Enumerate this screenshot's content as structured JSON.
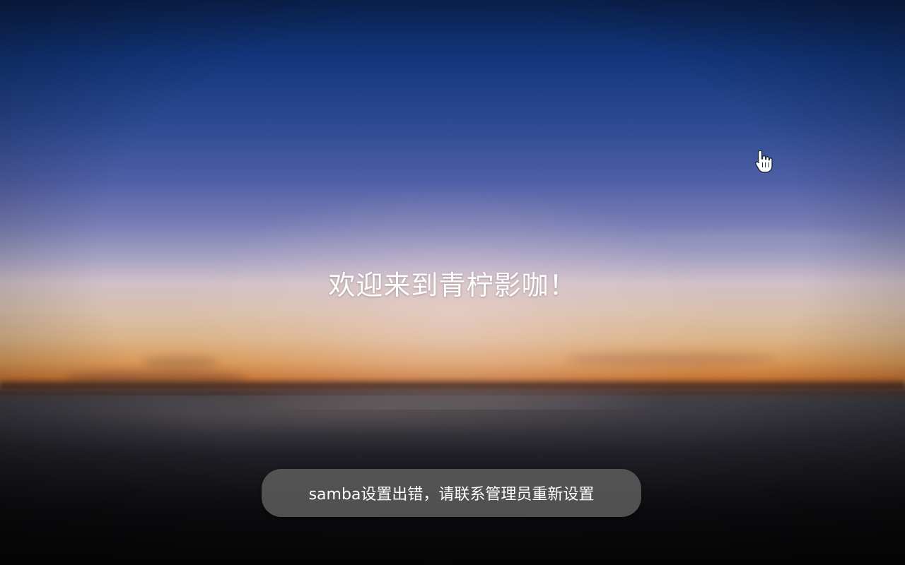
{
  "welcome": {
    "message": "欢迎来到青柠影咖！"
  },
  "toast": {
    "message": "samba设置出错，请联系管理员重新设置"
  },
  "cursor": {
    "icon": "hand-pointer-icon"
  },
  "colors": {
    "toast_background": "#646464",
    "text": "#ffffff"
  }
}
